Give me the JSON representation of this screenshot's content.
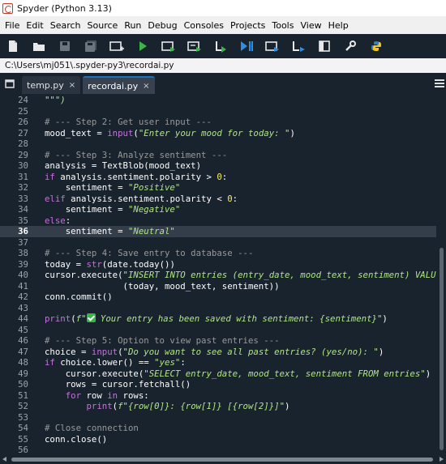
{
  "window": {
    "title": "Spyder (Python 3.13)"
  },
  "menu": [
    "File",
    "Edit",
    "Search",
    "Source",
    "Run",
    "Debug",
    "Consoles",
    "Projects",
    "Tools",
    "View",
    "Help"
  ],
  "toolbar_icons": [
    "new-file-icon",
    "open-folder-icon",
    "save-icon",
    "save-all-icon",
    "create-cell-icon",
    "run-icon",
    "run-cell-icon",
    "run-cell-advance-icon",
    "run-selection-icon",
    "debug-icon",
    "run-to-line-icon",
    "debug-cell-icon",
    "maximize-pane-icon",
    "tools-wrench-icon",
    "python-path-icon"
  ],
  "path": "C:\\Users\\mj051\\.spyder-py3\\recordai.py",
  "tabs": [
    {
      "label": "temp.py",
      "close": "×",
      "active": false
    },
    {
      "label": "recordai.py",
      "close": "×",
      "active": true
    }
  ],
  "editor": {
    "current_line": 36,
    "lines": [
      {
        "n": "24",
        "t": "\"\"\")"
      },
      {
        "n": "25",
        "t": ""
      },
      {
        "n": "26",
        "t": "# --- Step 2: Get user input ---"
      },
      {
        "n": "27",
        "t": "mood_text = input(\"Enter your mood for today: \")"
      },
      {
        "n": "28",
        "t": ""
      },
      {
        "n": "29",
        "t": "# --- Step 3: Analyze sentiment ---"
      },
      {
        "n": "30",
        "t": "analysis = TextBlob(mood_text)"
      },
      {
        "n": "31",
        "t": "if analysis.sentiment.polarity > 0:"
      },
      {
        "n": "32",
        "t": "    sentiment = \"Positive\""
      },
      {
        "n": "33",
        "t": "elif analysis.sentiment.polarity < 0:"
      },
      {
        "n": "34",
        "t": "    sentiment = \"Negative\""
      },
      {
        "n": "35",
        "t": "else:"
      },
      {
        "n": "36",
        "t": "    sentiment = \"Neutral\""
      },
      {
        "n": "37",
        "t": ""
      },
      {
        "n": "38",
        "t": "# --- Step 4: Save entry to database ---"
      },
      {
        "n": "39",
        "t": "today = str(date.today())"
      },
      {
        "n": "40",
        "t": "cursor.execute(\"INSERT INTO entries (entry_date, mood_text, sentiment) VALUES (?, ?, ?)\","
      },
      {
        "n": "41",
        "t": "               (today, mood_text, sentiment))"
      },
      {
        "n": "42",
        "t": "conn.commit()"
      },
      {
        "n": "43",
        "t": ""
      },
      {
        "n": "44",
        "t": "print(f\"✅ Your entry has been saved with sentiment: {sentiment}\")"
      },
      {
        "n": "45",
        "t": ""
      },
      {
        "n": "46",
        "t": "# --- Step 5: Option to view past entries ---"
      },
      {
        "n": "47",
        "t": "choice = input(\"Do you want to see all past entries? (yes/no): \")"
      },
      {
        "n": "48",
        "t": "if choice.lower() == \"yes\":"
      },
      {
        "n": "49",
        "t": "    cursor.execute(\"SELECT entry_date, mood_text, sentiment FROM entries\")"
      },
      {
        "n": "50",
        "t": "    rows = cursor.fetchall()"
      },
      {
        "n": "51",
        "t": "    for row in rows:"
      },
      {
        "n": "52",
        "t": "        print(f\"{row[0]}: {row[1]} [{row[2]}]\")"
      },
      {
        "n": "53",
        "t": ""
      },
      {
        "n": "54",
        "t": "# Close connection"
      },
      {
        "n": "55",
        "t": "conn.close()"
      },
      {
        "n": "56",
        "t": ""
      }
    ]
  },
  "colors": {
    "background": "#19232d",
    "keyword": "#c670e0",
    "string": "#b0e686",
    "comment": "#999999",
    "number": "#faed5c",
    "current_line": "#343e4a"
  }
}
